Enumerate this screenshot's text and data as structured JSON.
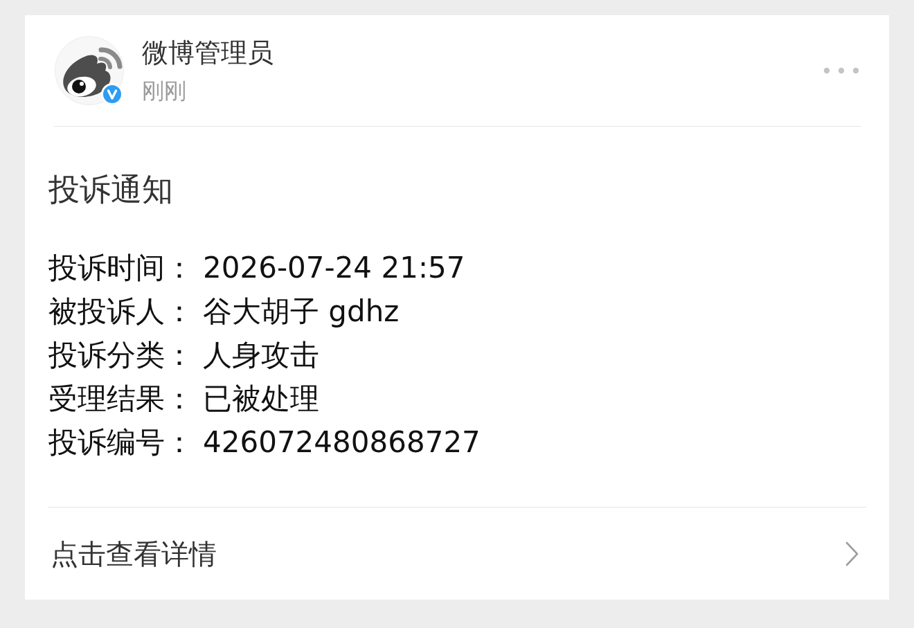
{
  "header": {
    "name": "微博管理员",
    "time": "刚刚",
    "verified": true
  },
  "notice": {
    "title": "投诉通知",
    "fields": [
      {
        "label": "投诉时间：",
        "value": "2026-07-24 21:57"
      },
      {
        "label": "被投诉人：",
        "value": "谷大胡子 gdhz"
      },
      {
        "label": "投诉分类：",
        "value": "人身攻击"
      },
      {
        "label": "受理结果：",
        "value": "已被处理"
      },
      {
        "label": "投诉编号：",
        "value": "426072480868727"
      }
    ]
  },
  "footer": {
    "link": "点击查看详情"
  }
}
